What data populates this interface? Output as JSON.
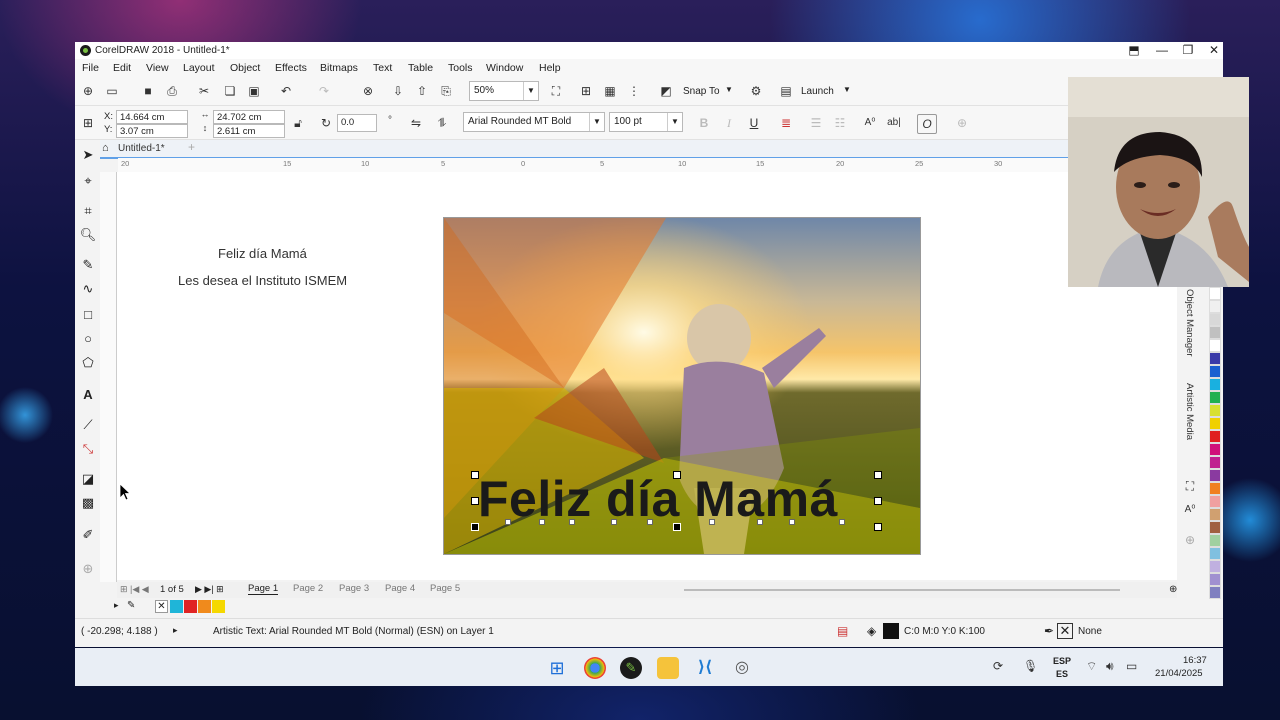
{
  "window": {
    "title": "CorelDRAW 2018 - Untitled-1*",
    "controls": [
      "⬒",
      "—",
      "❐",
      "✕"
    ]
  },
  "menu": [
    "File",
    "Edit",
    "View",
    "Layout",
    "Object",
    "Effects",
    "Bitmaps",
    "Text",
    "Table",
    "Tools",
    "Window",
    "Help"
  ],
  "toolbar": {
    "zoom": "50%",
    "snap_to": "Snap To",
    "launch": "Launch"
  },
  "property_bar": {
    "x": "14.664 cm",
    "y": "3.07 cm",
    "x_label": "X:",
    "y_label": "Y:",
    "width": "24.702 cm",
    "height": "2.611 cm",
    "rotation": "0.0",
    "font": "Arial Rounded MT Bold",
    "font_size": "100 pt"
  },
  "doc_tab": "Untitled-1*",
  "ruler_h": [
    "20",
    "15",
    "10",
    "5",
    "0",
    "5",
    "10",
    "15",
    "20",
    "25",
    "30"
  ],
  "canvas": {
    "line1": "Feliz día Mamá",
    "line2": "Les desea el Instituto ISMEM",
    "artistic_text": "Feliz día Mamá"
  },
  "pages": {
    "counter": "1 of 5",
    "tabs": [
      "Page 1",
      "Page 2",
      "Page 3",
      "Page 4",
      "Page 5"
    ]
  },
  "palette_swatches": [
    "#1fb5d8",
    "#e02424",
    "#f08a1c",
    "#f5d800"
  ],
  "right_palette": [
    "#ffffff",
    "#f0f0f0",
    "#d8d8d8",
    "#c0c0c0",
    "#ffffff",
    "#3a3aa8",
    "#1a5fd0",
    "#19b0e0",
    "#20b050",
    "#d8e030",
    "#f0d000",
    "#e02020",
    "#d0107a",
    "#c02090",
    "#8a3aa0",
    "#f08020",
    "#f0a0a0",
    "#d0a070",
    "#a06040",
    "#a0d0a0",
    "#80c0e0",
    "#c0b0e0",
    "#a090d0",
    "#8080c0"
  ],
  "dockers": {
    "object_manager": "Object Manager",
    "artistic_media": "Artistic Media"
  },
  "status": {
    "coords": "( -20.298; 4.188 )",
    "message": "Artistic Text: Arial Rounded MT Bold (Normal) (ESN) on Layer 1",
    "fill": "C:0 M:0 Y:0 K:100",
    "outline": "None"
  },
  "taskbar": {
    "lang_top": "ESP",
    "lang_bottom": "ES",
    "time": "16:37",
    "date": "21/04/2025"
  }
}
